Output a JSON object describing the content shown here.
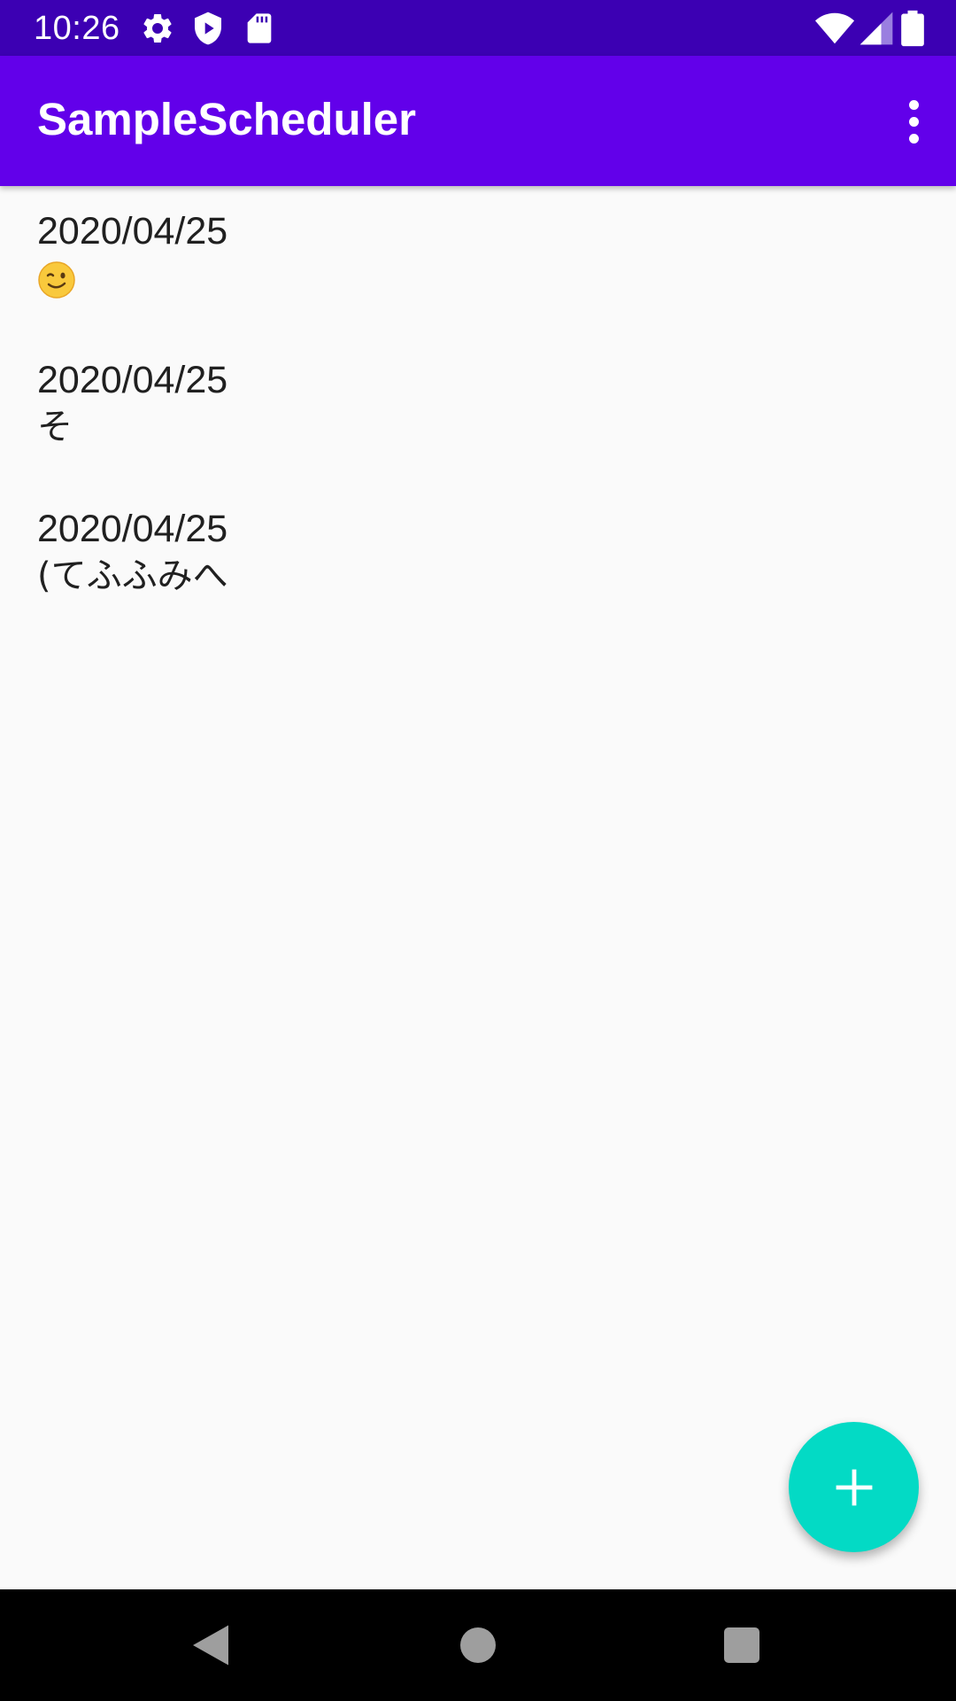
{
  "status_bar": {
    "time": "10:26",
    "left_icons": [
      "gear-icon",
      "shield-icon",
      "sd-card-icon"
    ],
    "right_icons": [
      "wifi-icon",
      "cell-signal-icon",
      "battery-icon"
    ],
    "background": "#3c00b3"
  },
  "app_bar": {
    "title": "SampleScheduler",
    "menu_icon": "more-vert-icon",
    "background": "#6200ea"
  },
  "schedules": [
    {
      "date": "2020/04/25",
      "title": "😉",
      "title_icon": "winking-face-emoji"
    },
    {
      "date": "2020/04/25",
      "title": "そ"
    },
    {
      "date": "2020/04/25",
      "title": "(てふふみへ"
    }
  ],
  "fab": {
    "icon": "plus-icon",
    "color": "#03dac5"
  },
  "nav_bar": {
    "buttons": [
      "back-icon",
      "home-icon",
      "recents-icon"
    ]
  }
}
